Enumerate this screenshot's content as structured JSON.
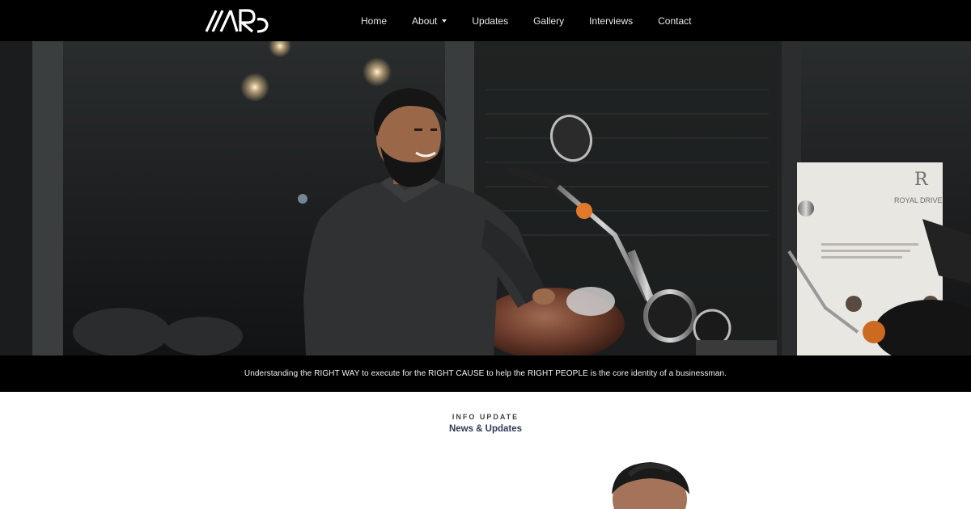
{
  "brand": {
    "logo_text": "MRD"
  },
  "nav": {
    "items": [
      {
        "label": "Home"
      },
      {
        "label": "About"
      },
      {
        "label": "Updates"
      },
      {
        "label": "Gallery"
      },
      {
        "label": "Interviews"
      },
      {
        "label": "Contact"
      }
    ]
  },
  "hero": {
    "poster": {
      "heading": "ROYAL DRIVE"
    }
  },
  "tagline": "Understanding the RIGHT WAY to execute for the RIGHT CAUSE to help the RIGHT PEOPLE is the core identity of a businessman.",
  "info": {
    "eyebrow": "INFO UPDATE",
    "title": "News & Updates"
  },
  "colors": {
    "nav_bg": "#000000",
    "nav_text": "#e8e8e8",
    "title_color": "#2f3a55"
  }
}
